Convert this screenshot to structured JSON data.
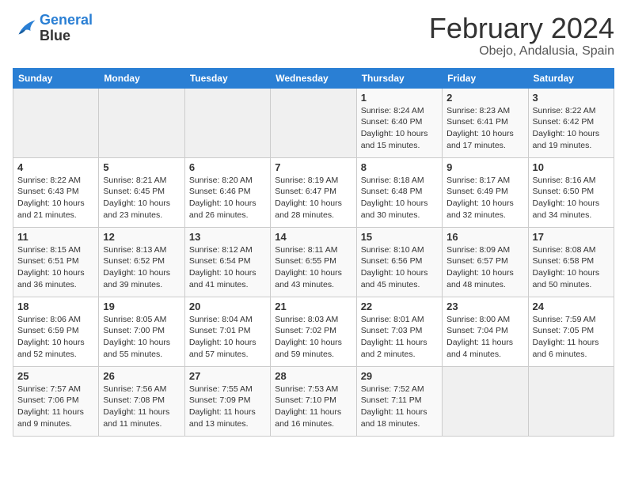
{
  "logo": {
    "line1": "General",
    "line2": "Blue"
  },
  "title": {
    "month": "February 2024",
    "location": "Obejo, Andalusia, Spain"
  },
  "headers": [
    "Sunday",
    "Monday",
    "Tuesday",
    "Wednesday",
    "Thursday",
    "Friday",
    "Saturday"
  ],
  "weeks": [
    [
      {
        "day": "",
        "detail": ""
      },
      {
        "day": "",
        "detail": ""
      },
      {
        "day": "",
        "detail": ""
      },
      {
        "day": "",
        "detail": ""
      },
      {
        "day": "1",
        "detail": "Sunrise: 8:24 AM\nSunset: 6:40 PM\nDaylight: 10 hours\nand 15 minutes."
      },
      {
        "day": "2",
        "detail": "Sunrise: 8:23 AM\nSunset: 6:41 PM\nDaylight: 10 hours\nand 17 minutes."
      },
      {
        "day": "3",
        "detail": "Sunrise: 8:22 AM\nSunset: 6:42 PM\nDaylight: 10 hours\nand 19 minutes."
      }
    ],
    [
      {
        "day": "4",
        "detail": "Sunrise: 8:22 AM\nSunset: 6:43 PM\nDaylight: 10 hours\nand 21 minutes."
      },
      {
        "day": "5",
        "detail": "Sunrise: 8:21 AM\nSunset: 6:45 PM\nDaylight: 10 hours\nand 23 minutes."
      },
      {
        "day": "6",
        "detail": "Sunrise: 8:20 AM\nSunset: 6:46 PM\nDaylight: 10 hours\nand 26 minutes."
      },
      {
        "day": "7",
        "detail": "Sunrise: 8:19 AM\nSunset: 6:47 PM\nDaylight: 10 hours\nand 28 minutes."
      },
      {
        "day": "8",
        "detail": "Sunrise: 8:18 AM\nSunset: 6:48 PM\nDaylight: 10 hours\nand 30 minutes."
      },
      {
        "day": "9",
        "detail": "Sunrise: 8:17 AM\nSunset: 6:49 PM\nDaylight: 10 hours\nand 32 minutes."
      },
      {
        "day": "10",
        "detail": "Sunrise: 8:16 AM\nSunset: 6:50 PM\nDaylight: 10 hours\nand 34 minutes."
      }
    ],
    [
      {
        "day": "11",
        "detail": "Sunrise: 8:15 AM\nSunset: 6:51 PM\nDaylight: 10 hours\nand 36 minutes."
      },
      {
        "day": "12",
        "detail": "Sunrise: 8:13 AM\nSunset: 6:52 PM\nDaylight: 10 hours\nand 39 minutes."
      },
      {
        "day": "13",
        "detail": "Sunrise: 8:12 AM\nSunset: 6:54 PM\nDaylight: 10 hours\nand 41 minutes."
      },
      {
        "day": "14",
        "detail": "Sunrise: 8:11 AM\nSunset: 6:55 PM\nDaylight: 10 hours\nand 43 minutes."
      },
      {
        "day": "15",
        "detail": "Sunrise: 8:10 AM\nSunset: 6:56 PM\nDaylight: 10 hours\nand 45 minutes."
      },
      {
        "day": "16",
        "detail": "Sunrise: 8:09 AM\nSunset: 6:57 PM\nDaylight: 10 hours\nand 48 minutes."
      },
      {
        "day": "17",
        "detail": "Sunrise: 8:08 AM\nSunset: 6:58 PM\nDaylight: 10 hours\nand 50 minutes."
      }
    ],
    [
      {
        "day": "18",
        "detail": "Sunrise: 8:06 AM\nSunset: 6:59 PM\nDaylight: 10 hours\nand 52 minutes."
      },
      {
        "day": "19",
        "detail": "Sunrise: 8:05 AM\nSunset: 7:00 PM\nDaylight: 10 hours\nand 55 minutes."
      },
      {
        "day": "20",
        "detail": "Sunrise: 8:04 AM\nSunset: 7:01 PM\nDaylight: 10 hours\nand 57 minutes."
      },
      {
        "day": "21",
        "detail": "Sunrise: 8:03 AM\nSunset: 7:02 PM\nDaylight: 10 hours\nand 59 minutes."
      },
      {
        "day": "22",
        "detail": "Sunrise: 8:01 AM\nSunset: 7:03 PM\nDaylight: 11 hours\nand 2 minutes."
      },
      {
        "day": "23",
        "detail": "Sunrise: 8:00 AM\nSunset: 7:04 PM\nDaylight: 11 hours\nand 4 minutes."
      },
      {
        "day": "24",
        "detail": "Sunrise: 7:59 AM\nSunset: 7:05 PM\nDaylight: 11 hours\nand 6 minutes."
      }
    ],
    [
      {
        "day": "25",
        "detail": "Sunrise: 7:57 AM\nSunset: 7:06 PM\nDaylight: 11 hours\nand 9 minutes."
      },
      {
        "day": "26",
        "detail": "Sunrise: 7:56 AM\nSunset: 7:08 PM\nDaylight: 11 hours\nand 11 minutes."
      },
      {
        "day": "27",
        "detail": "Sunrise: 7:55 AM\nSunset: 7:09 PM\nDaylight: 11 hours\nand 13 minutes."
      },
      {
        "day": "28",
        "detail": "Sunrise: 7:53 AM\nSunset: 7:10 PM\nDaylight: 11 hours\nand 16 minutes."
      },
      {
        "day": "29",
        "detail": "Sunrise: 7:52 AM\nSunset: 7:11 PM\nDaylight: 11 hours\nand 18 minutes."
      },
      {
        "day": "",
        "detail": ""
      },
      {
        "day": "",
        "detail": ""
      }
    ]
  ]
}
